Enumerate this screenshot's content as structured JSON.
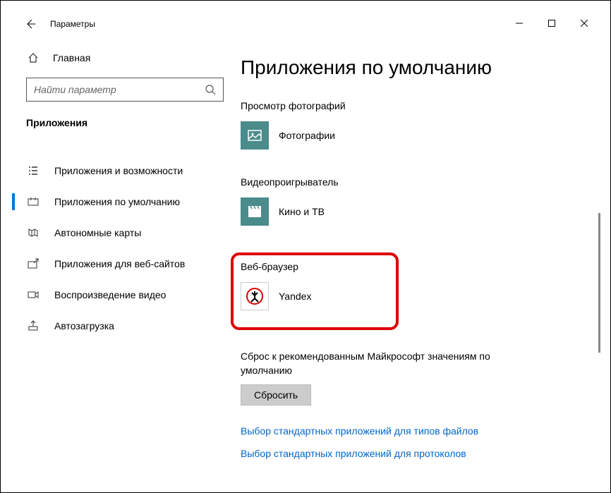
{
  "titlebar": {
    "title": "Параметры"
  },
  "sidebar": {
    "home": "Главная",
    "search_placeholder": "Найти параметр",
    "section": "Приложения",
    "items": [
      {
        "label": "Приложения и возможности"
      },
      {
        "label": "Приложения по умолчанию"
      },
      {
        "label": "Автономные карты"
      },
      {
        "label": "Приложения для веб-сайтов"
      },
      {
        "label": "Воспроизведение видео"
      },
      {
        "label": "Автозагрузка"
      }
    ]
  },
  "main": {
    "heading": "Приложения по умолчанию",
    "categories": [
      {
        "label": "Просмотр фотографий",
        "app": "Фотографии"
      },
      {
        "label": "Видеопроигрыватель",
        "app": "Кино и ТВ"
      },
      {
        "label": "Веб-браузер",
        "app": "Yandex"
      }
    ],
    "reset_desc": "Сброс к рекомендованным Майкрософт значениям по умолчанию",
    "reset_btn": "Сбросить",
    "links": [
      "Выбор стандартных приложений для типов файлов",
      "Выбор стандартных приложений для протоколов"
    ]
  }
}
